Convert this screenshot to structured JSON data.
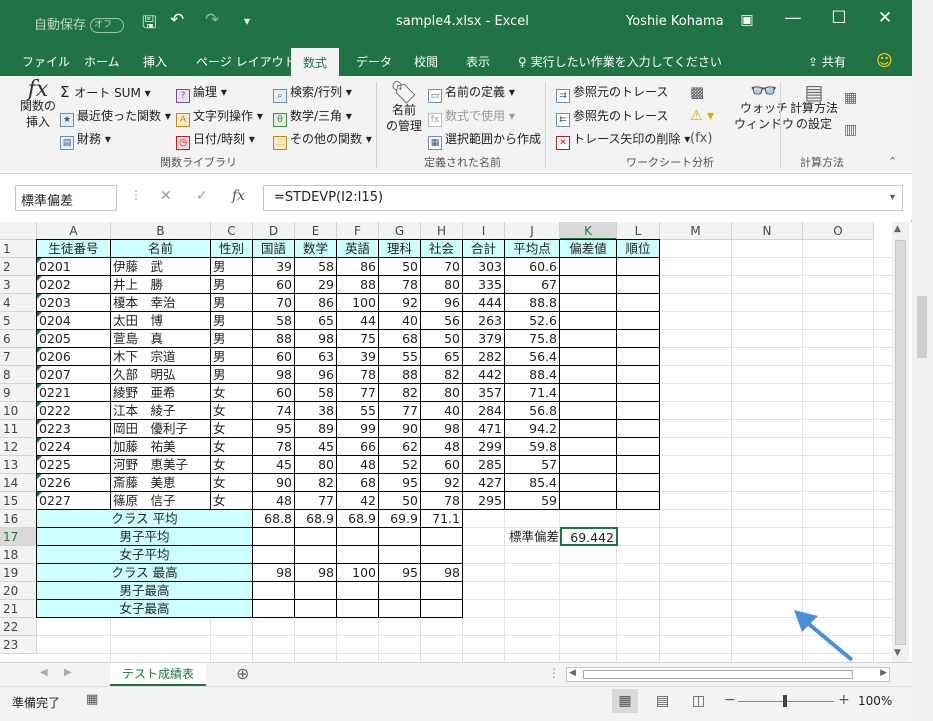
{
  "titlebar": {
    "autosave": "自動保存",
    "autosave_state": "オフ",
    "filename": "sample4.xlsx",
    "app": "Excel",
    "sep": "-",
    "user": "Yoshie Kohama"
  },
  "tabs": [
    "ファイル",
    "ホーム",
    "挿入",
    "ページ レイアウト",
    "数式",
    "データ",
    "校閲",
    "表示"
  ],
  "tell_me": "実行したい作業を入力してください",
  "share": "共有",
  "ribbon": {
    "insert_function": [
      "関数の",
      "挿入"
    ],
    "autosum": "オート SUM",
    "recent": "最近使った関数",
    "financial": "財務",
    "logical": "論理",
    "text": "文字列操作",
    "datetime": "日付/時刻",
    "lookup": "検索/行列",
    "math": "数学/三角",
    "more": "その他の関数",
    "group_library": "関数ライブラリ",
    "name_manager": [
      "名前",
      "の管理"
    ],
    "define_name": "名前の定義",
    "use_in_formula": "数式で使用",
    "create_from_selection": "選択範囲から作成",
    "group_names": "定義された名前",
    "trace_precedents": "参照元のトレース",
    "trace_dependents": "参照先のトレース",
    "remove_arrows": "トレース矢印の削除",
    "watch_window": [
      "ウォッチ",
      "ウィンドウ"
    ],
    "group_audit": "ワークシート分析",
    "calc_options": [
      "計算方法",
      "の設定"
    ],
    "group_calc": "計算方法"
  },
  "formula_bar": {
    "name_box": "標準偏差",
    "formula": "=STDEVP(I2:I15)",
    "fx": "fx"
  },
  "columns": [
    "A",
    "B",
    "C",
    "D",
    "E",
    "F",
    "G",
    "H",
    "I",
    "J",
    "K",
    "L",
    "M",
    "N",
    "O"
  ],
  "rows": [
    "1",
    "2",
    "3",
    "4",
    "5",
    "6",
    "7",
    "8",
    "9",
    "10",
    "11",
    "12",
    "13",
    "14",
    "15",
    "16",
    "17",
    "18",
    "19",
    "20",
    "21",
    "22",
    "23"
  ],
  "header_row": [
    "生徒番号",
    "名前",
    "性別",
    "国語",
    "数学",
    "英語",
    "理科",
    "社会",
    "合計",
    "平均点",
    "偏差値",
    "順位"
  ],
  "students": [
    [
      "0201",
      "伊藤　武",
      "男",
      "39",
      "58",
      "86",
      "50",
      "70",
      "303",
      "60.6"
    ],
    [
      "0202",
      "井上　勝",
      "男",
      "60",
      "29",
      "88",
      "78",
      "80",
      "335",
      "67"
    ],
    [
      "0203",
      "榎本　幸治",
      "男",
      "70",
      "86",
      "100",
      "92",
      "96",
      "444",
      "88.8"
    ],
    [
      "0204",
      "太田　博",
      "男",
      "58",
      "65",
      "44",
      "40",
      "56",
      "263",
      "52.6"
    ],
    [
      "0205",
      "萱島　真",
      "男",
      "88",
      "98",
      "75",
      "68",
      "50",
      "379",
      "75.8"
    ],
    [
      "0206",
      "木下　宗道",
      "男",
      "60",
      "63",
      "39",
      "55",
      "65",
      "282",
      "56.4"
    ],
    [
      "0207",
      "久部　明弘",
      "男",
      "98",
      "96",
      "78",
      "88",
      "82",
      "442",
      "88.4"
    ],
    [
      "0221",
      "綾野　亜希",
      "女",
      "60",
      "58",
      "77",
      "82",
      "80",
      "357",
      "71.4"
    ],
    [
      "0222",
      "江本　綾子",
      "女",
      "74",
      "38",
      "55",
      "77",
      "40",
      "284",
      "56.8"
    ],
    [
      "0223",
      "岡田　優利子",
      "女",
      "95",
      "89",
      "99",
      "90",
      "98",
      "471",
      "94.2"
    ],
    [
      "0224",
      "加藤　祐美",
      "女",
      "78",
      "45",
      "66",
      "62",
      "48",
      "299",
      "59.8"
    ],
    [
      "0225",
      "河野　恵美子",
      "女",
      "45",
      "80",
      "48",
      "52",
      "60",
      "285",
      "57"
    ],
    [
      "0226",
      "斎藤　美恵",
      "女",
      "90",
      "82",
      "68",
      "95",
      "92",
      "427",
      "85.4"
    ],
    [
      "0227",
      "篠原　信子",
      "女",
      "48",
      "77",
      "42",
      "50",
      "78",
      "295",
      "59"
    ]
  ],
  "summary": [
    {
      "label": "クラス 平均",
      "values": [
        "68.8",
        "68.9",
        "68.9",
        "69.9",
        "71.1"
      ]
    },
    {
      "label": "男子平均",
      "values": [
        "",
        "",
        "",
        "",
        ""
      ]
    },
    {
      "label": "女子平均",
      "values": [
        "",
        "",
        "",
        "",
        ""
      ]
    },
    {
      "label": "クラス 最高",
      "values": [
        "98",
        "98",
        "100",
        "95",
        "98"
      ]
    },
    {
      "label": "男子最高",
      "values": [
        "",
        "",
        "",
        "",
        ""
      ]
    },
    {
      "label": "女子最高",
      "values": [
        "",
        "",
        "",
        "",
        ""
      ]
    }
  ],
  "stdev_label": "標準偏差",
  "stdev_value": "69.442",
  "sheet_tab": "テスト成績表",
  "status": {
    "ready": "準備完了",
    "zoom": "100%"
  }
}
